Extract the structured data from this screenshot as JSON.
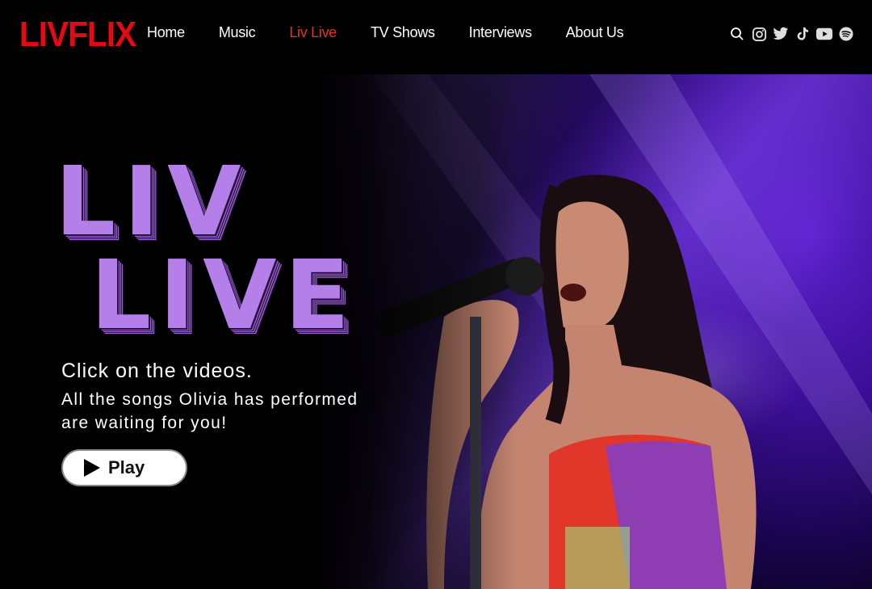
{
  "brand": {
    "logo": "LIVFLIX",
    "color": "#e50914"
  },
  "nav": {
    "items": [
      {
        "label": "Home",
        "active": false
      },
      {
        "label": "Music",
        "active": false
      },
      {
        "label": "Liv Live",
        "active": true
      },
      {
        "label": "TV Shows",
        "active": false
      },
      {
        "label": "Interviews",
        "active": false
      },
      {
        "label": "About Us",
        "active": false
      }
    ],
    "active_color": "#e5322d"
  },
  "social": {
    "icons": [
      "search-icon",
      "instagram-icon",
      "twitter-icon",
      "tiktok-icon",
      "youtube-icon",
      "spotify-icon"
    ]
  },
  "hero": {
    "title_line1": "LIV",
    "title_line2": "LIVE",
    "title_color": "#b47fe8",
    "cta_heading": "Click on the videos.",
    "cta_subtext": "All the songs Olivia has performed are waiting for you!",
    "play_label": "Play",
    "play_icon": "play-icon"
  }
}
